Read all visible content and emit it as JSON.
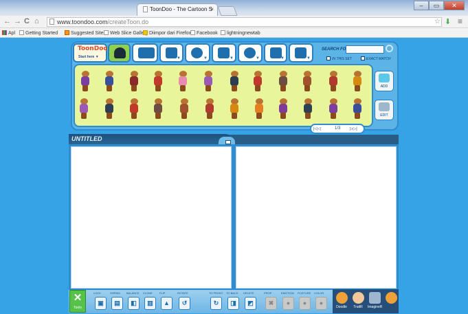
{
  "browser": {
    "tab_title": "ToonDoo - The Cartoon S",
    "tab_close": "×",
    "window_controls": {
      "minimize": "–",
      "maximize": "▭",
      "close": "✕"
    },
    "nav": {
      "back": "←",
      "forward": "→",
      "reload": "C",
      "home": "⌂"
    },
    "url_domain": "www.toondoo.com",
    "url_path": "/createToon.do",
    "star_icon": "☆",
    "menu_icon": "≡",
    "bookmarks": [
      "Apl",
      "Getting Started",
      "Suggested Sites",
      "Web Slice Gallery",
      "Diimpor dari Firefox",
      "Facebook",
      "lightningnewtab"
    ]
  },
  "app": {
    "logo_text": "ToonDoo",
    "start_here": "Start here ▼",
    "search_label": "SEARCH FOR",
    "search_value": "",
    "check_in_this_set": "IN THIS SET",
    "check_exact_match": "EXACT MATCH",
    "side_buttons": {
      "add": "ADD",
      "edit": "EDIT"
    },
    "pager": {
      "first": "|◁◁",
      "page": "1/3",
      "last": "▷▷|"
    },
    "toon_title": "UNTITLED",
    "tools_label": "Tools",
    "bottom_labels": [
      "LOCK",
      "SHRINK",
      "BALANCE",
      "CLONE",
      "FLIP",
      "ROTATE",
      "TO FRONT",
      "TO BACK",
      "DELETE",
      "PROP",
      "EMOTION",
      "POSTURE",
      "COLOR"
    ],
    "bottom_right": [
      "Doodle",
      "TraitR",
      "ImagineR"
    ]
  },
  "colors": {
    "page_bg": "#36a3e6",
    "char_panel": "#e8f59a",
    "title_bar": "#2a5d86",
    "accent_green": "#56c24a"
  }
}
